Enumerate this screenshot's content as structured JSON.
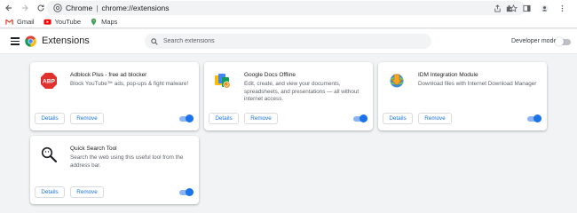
{
  "browser": {
    "scheme": "Chrome",
    "url": "chrome://extensions"
  },
  "bookmarks": [
    {
      "label": "Gmail",
      "icon": "gmail-icon"
    },
    {
      "label": "YouTube",
      "icon": "youtube-icon"
    },
    {
      "label": "Maps",
      "icon": "maps-icon"
    }
  ],
  "header": {
    "title": "Extensions",
    "search_placeholder": "Search extensions",
    "developer_mode_label": "Developer mode",
    "developer_mode_on": false
  },
  "buttons": {
    "details": "Details",
    "remove": "Remove"
  },
  "extensions": [
    {
      "name": "Adblock Plus - free ad blocker",
      "description": "Block YouTube™ ads, pop-ups & fight malware!",
      "icon": "abp-icon",
      "enabled": true
    },
    {
      "name": "Google Docs Offline",
      "description": "Edit, create, and view your documents, spreadsheets, and presentations — all without internet access.",
      "icon": "google-docs-offline-icon",
      "enabled": true
    },
    {
      "name": "IDM Integration Module",
      "description": "Download files with Internet Download Manager",
      "icon": "idm-icon",
      "enabled": true
    },
    {
      "name": "Quick Search Tool",
      "description": "Search the web using this useful tool from the address bar.",
      "icon": "quick-search-icon",
      "enabled": true
    }
  ],
  "colors": {
    "accent": "#1a73e8",
    "toggle_track_on": "#8ab4f8",
    "page_background": "#f1f3f4"
  }
}
